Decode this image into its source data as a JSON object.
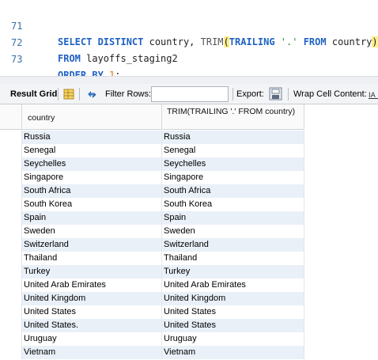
{
  "editor": {
    "lines": [
      {
        "number": "71",
        "parts": [
          {
            "t": "SELECT DISTINCT ",
            "k": "kw"
          },
          {
            "t": "country, ",
            "k": ""
          },
          {
            "t": "TRIM",
            "k": "fn"
          },
          {
            "t": "(",
            "k": "paren-hl"
          },
          {
            "t": "TRAILING ",
            "k": "kw"
          },
          {
            "t": "'.'",
            "k": "str"
          },
          {
            "t": " FROM ",
            "k": "kw"
          },
          {
            "t": "country",
            "k": ""
          },
          {
            "t": ")",
            "k": "paren-hl"
          }
        ]
      },
      {
        "number": "72",
        "parts": [
          {
            "t": "FROM ",
            "k": "kw"
          },
          {
            "t": "layoffs_staging2",
            "k": ""
          }
        ]
      },
      {
        "number": "73",
        "parts": [
          {
            "t": "ORDER BY ",
            "k": "kw"
          },
          {
            "t": "1",
            "k": "num"
          },
          {
            "t": ";",
            "k": ""
          }
        ]
      }
    ]
  },
  "toolbar": {
    "result_grid": "Result Grid",
    "filter_rows": "Filter Rows:",
    "filter_value": "",
    "export": "Export:",
    "wrap_cell": "Wrap Cell Content:"
  },
  "grid": {
    "columns": [
      "country",
      "TRIM(TRAILING '.' FROM country)"
    ],
    "rows": [
      [
        "Russia",
        "Russia"
      ],
      [
        "Senegal",
        "Senegal"
      ],
      [
        "Seychelles",
        "Seychelles"
      ],
      [
        "Singapore",
        "Singapore"
      ],
      [
        "South Africa",
        "South Africa"
      ],
      [
        "South Korea",
        "South Korea"
      ],
      [
        "Spain",
        "Spain"
      ],
      [
        "Sweden",
        "Sweden"
      ],
      [
        "Switzerland",
        "Switzerland"
      ],
      [
        "Thailand",
        "Thailand"
      ],
      [
        "Turkey",
        "Turkey"
      ],
      [
        "United Arab Emirates",
        "United Arab Emirates"
      ],
      [
        "United Kingdom",
        "United Kingdom"
      ],
      [
        "United States",
        "United States"
      ],
      [
        "United States.",
        "United States"
      ],
      [
        "Uruguay",
        "Uruguay"
      ],
      [
        "Vietnam",
        "Vietnam"
      ]
    ]
  },
  "icons": {
    "grid_view": "grid-view-icon",
    "refresh": "refresh-icon",
    "export": "export-icon",
    "wrap": "wrap-text-icon"
  }
}
